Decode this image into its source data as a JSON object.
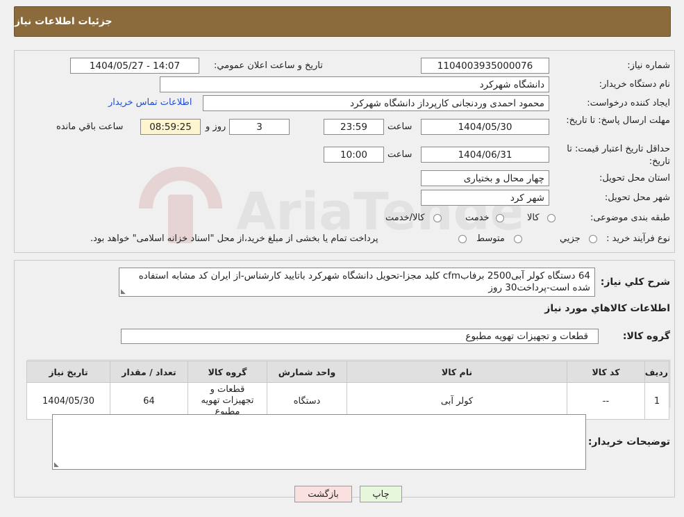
{
  "header": {
    "title": "جزئيات اطلاعات نياز"
  },
  "watermark": {
    "text": "AriaTender.neT"
  },
  "fields": {
    "need_number_label": "شماره نياز:",
    "need_number": "1104003935000076",
    "announce_label": "تاريخ و ساعت اعلان عمومي:",
    "announce_value": "1404/05/27 - 14:07",
    "buyer_org_label": "نام دستگاه خريدار:",
    "buyer_org": "دانشگاه شهرکرد",
    "requester_label": "ايجاد کننده درخواست:",
    "requester": "محمود احمدی وردنجانی کارپرداز دانشگاه شهرکرد",
    "contact_link": "اطلاعات تماس خريدار",
    "deadline_label": "مهلت ارسال پاسخ: تا تاريخ:",
    "deadline_date": "1404/05/30",
    "time_label": "ساعت",
    "deadline_time": "23:59",
    "days_value": "3",
    "days_label": "روز و",
    "remaining_time": "08:59:25",
    "remaining_label": "ساعت باقي مانده",
    "price_validity_label": "حداقل تاريخ اعتبار قيمت: تا تاريخ:",
    "price_validity_date": "1404/06/31",
    "price_validity_time": "10:00",
    "province_label": "استان محل تحويل:",
    "province": "چهار محال و بختياری",
    "city_label": "شهر محل تحويل:",
    "city": "شهر کرد",
    "category_label": "طبقه بندی موضوعی:",
    "category_options": [
      "کالا",
      "خدمت",
      "کالا/خدمت"
    ],
    "process_label": "نوع فرآيند خريد :",
    "process_options": [
      "جزيي",
      "متوسط"
    ],
    "process_note": "پرداخت تمام يا بخشی از مبلغ خريد،از محل \"اسناد خزانه اسلامی\" خواهد بود."
  },
  "description": {
    "label": "شرح کلي نياز:",
    "text": "64 دستگاه کولر آبی2500 برفابcfm کلید مجزا-تحویل دانشگاه شهرکرد باتایید کارشناس-از ایران کد مشابه استفاده شده است-پرداخت30 روز"
  },
  "goods_section": {
    "title": "اطلاعات کالاهاي مورد نياز",
    "group_label": "گروه کالا:",
    "group_value": "قطعات و تجهیزات تهویه مطبوع"
  },
  "table": {
    "headers": [
      "رديف",
      "کد کالا",
      "نام کالا",
      "واحد شمارش",
      "گروه کالا",
      "تعداد / مقدار",
      "تاريخ نياز"
    ],
    "rows": [
      [
        "1",
        "--",
        "کولر آبی",
        "دستگاه",
        "قطعات و تجهیزات تهویه مطبوع",
        "64",
        "1404/05/30"
      ]
    ]
  },
  "buyer_notes": {
    "label": "توضيحات خريدار:"
  },
  "buttons": {
    "print": "چاپ",
    "back": "بازگشت"
  },
  "colors": {
    "header_bg": "#8b6b3c",
    "back_btn": "#fbe0e0",
    "print_btn": "#e6f7dc",
    "link": "#1f4fd6"
  }
}
